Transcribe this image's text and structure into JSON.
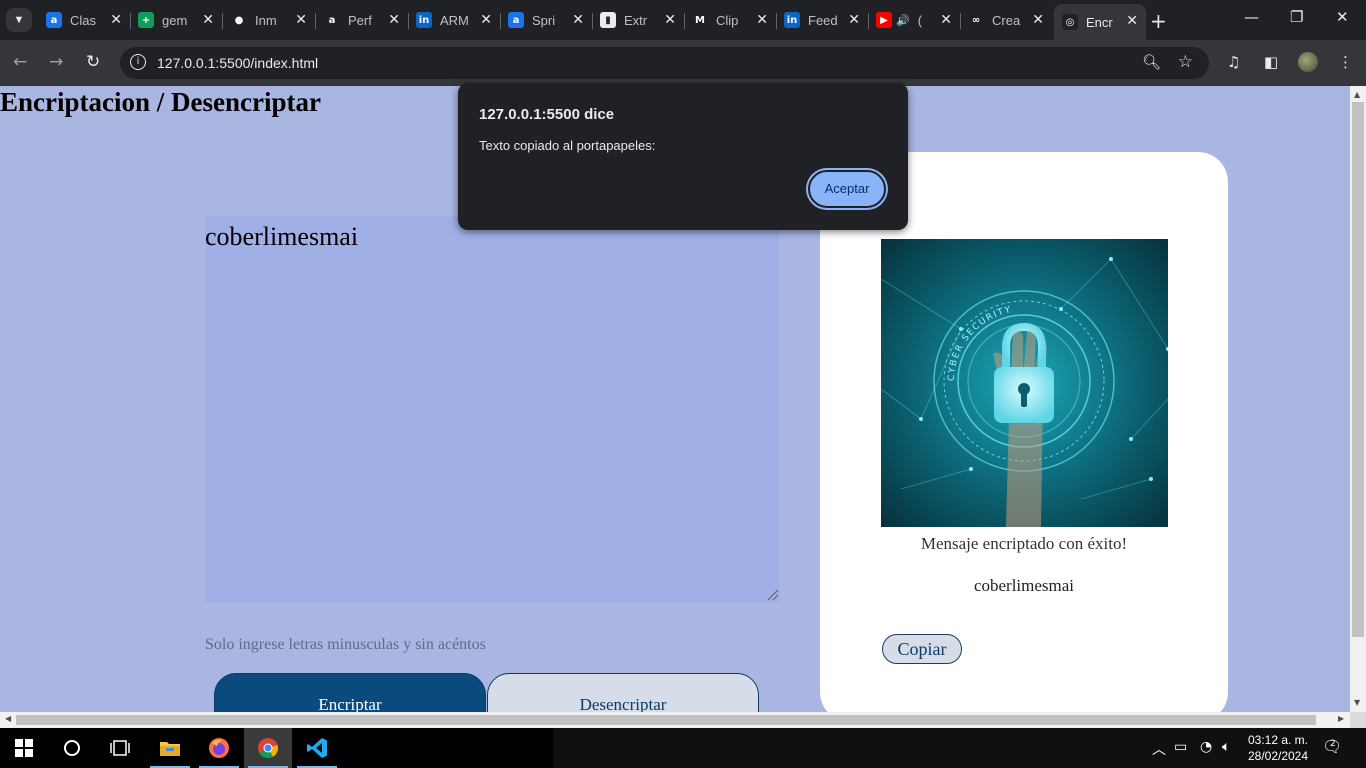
{
  "browser": {
    "tabs": [
      {
        "title": "Clas",
        "icon": "alura-icon",
        "color": "#1a73e8",
        "glyph": "a"
      },
      {
        "title": "gem",
        "icon": "sheets-icon",
        "color": "#0f9d58",
        "glyph": "+"
      },
      {
        "title": "Inm",
        "icon": "github-icon",
        "color": "#202124",
        "glyph": "●"
      },
      {
        "title": "Perf",
        "icon": "alura-icon",
        "color": "#202124",
        "glyph": "a"
      },
      {
        "title": "ARM",
        "icon": "linkedin-icon",
        "color": "#0a66c2",
        "glyph": "in"
      },
      {
        "title": "Spri",
        "icon": "alura-icon",
        "color": "#1a73e8",
        "glyph": "a"
      },
      {
        "title": "Extr",
        "icon": "trello-icon",
        "color": "#e8eaed",
        "glyph": "▮"
      },
      {
        "title": "Clip",
        "icon": "medium-icon",
        "color": "#202124",
        "glyph": "M"
      },
      {
        "title": "Feed",
        "icon": "linkedin-icon",
        "color": "#0a66c2",
        "glyph": "in"
      },
      {
        "title": "(",
        "icon": "youtube-icon",
        "color": "#ff0000",
        "glyph": "▶",
        "audio": "🔊"
      },
      {
        "title": "Crea",
        "icon": "infinity-icon",
        "color": "#202124",
        "glyph": "∞"
      },
      {
        "title": "Encr",
        "icon": "globe-icon",
        "color": "#202124",
        "glyph": "◎",
        "active": true
      }
    ],
    "url": "127.0.0.1:5500/index.html"
  },
  "page": {
    "title": "Encriptacion / Desencriptar",
    "input_value": "coberlimesmai",
    "hint": "Solo ingrese letras minusculas y sin acéntos",
    "encrypt_label": "Encriptar",
    "decrypt_label": "Desencriptar",
    "success_message": "Mensaje encriptado con éxito!",
    "result_text": "coberlimesmai",
    "copy_label": "Copiar",
    "image_text": "CYBER SECURITY"
  },
  "alert": {
    "title": "127.0.0.1:5500 dice",
    "message": "Texto copiado al portapapeles:",
    "ok_label": "Aceptar"
  },
  "taskbar": {
    "time": "03:12 a. m.",
    "date": "28/02/2024",
    "notifications": "2"
  },
  "colors": {
    "page_bg": "#a9b6e2",
    "textarea_bg": "#a0b0e6",
    "primary_button": "#0a4a7d",
    "alert_button": "#8ab4f8"
  }
}
